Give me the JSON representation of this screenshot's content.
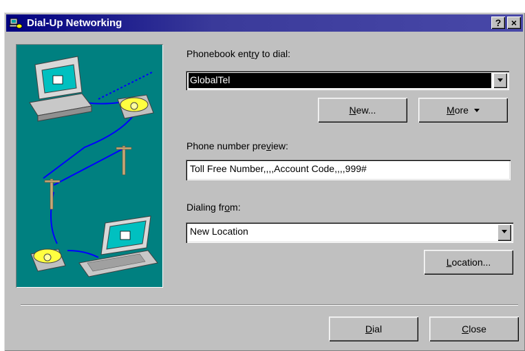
{
  "window": {
    "title": "Dial-Up Networking",
    "help_label": "?",
    "close_label": "×"
  },
  "colors": {
    "titlebar": "#000080",
    "illustration_bg": "#008080",
    "face": "#c0c0c0"
  },
  "icons": {
    "title": "dialup-networking-icon",
    "computer": "desktop-computer-icon",
    "phone": "telephone-icon",
    "laptop": "laptop-icon",
    "pole": "telephone-pole-icon"
  },
  "phonebook": {
    "label_pre": "Phonebook ent",
    "label_accel": "r",
    "label_post": "y to dial:",
    "value": "GlobalTel"
  },
  "buttons": {
    "new_accel": "N",
    "new_rest": "ew...",
    "more_accel": "M",
    "more_rest": "ore",
    "location_accel": "L",
    "location_rest": "ocation...",
    "dial_accel": "D",
    "dial_rest": "ial",
    "close_accel": "C",
    "close_rest": "lose"
  },
  "preview": {
    "label_pre": "Phone number pre",
    "label_accel": "v",
    "label_post": "iew:",
    "value": "Toll Free Number,,,,Account Code,,,,999#"
  },
  "dialing": {
    "label_pre": "Dialing fr",
    "label_accel": "o",
    "label_post": "m:",
    "value": "New Location"
  }
}
